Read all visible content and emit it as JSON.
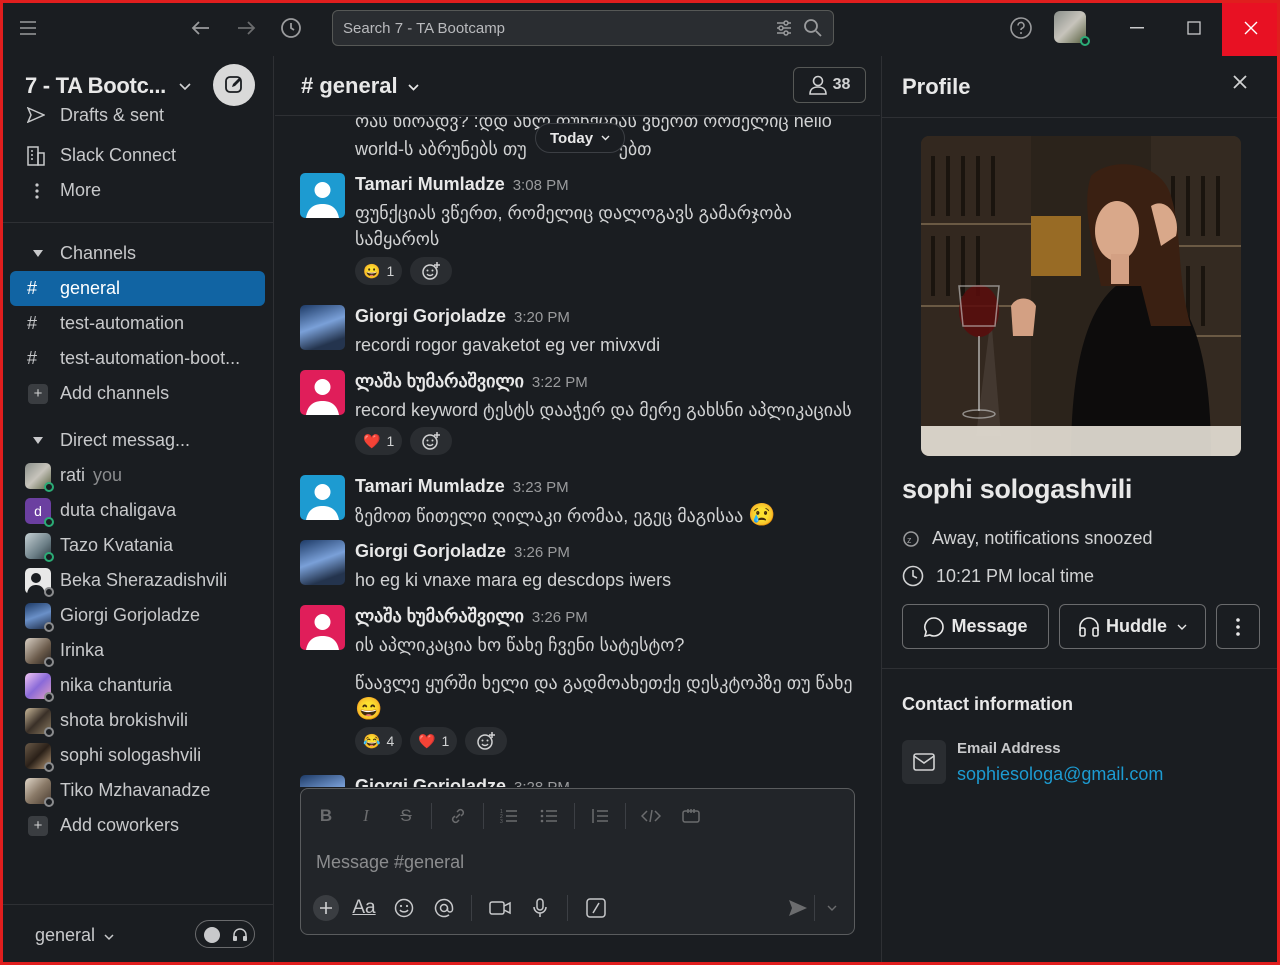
{
  "titlebar": {
    "search_placeholder": "Search 7 - TA Bootcamp"
  },
  "sidebar": {
    "workspace": "7 - TA Bootc...",
    "nav": [
      {
        "label": "Drafts & sent",
        "icon": "send-icon"
      },
      {
        "label": "Slack Connect",
        "icon": "building-icon"
      },
      {
        "label": "More",
        "icon": "more-vertical-icon"
      }
    ],
    "channels_header": "Channels",
    "channels": [
      {
        "label": "general",
        "active": true
      },
      {
        "label": "test-automation",
        "active": false
      },
      {
        "label": "test-automation-boot...",
        "active": false
      }
    ],
    "add_channels": "Add channels",
    "dm_header": "Direct messag...",
    "dms": [
      {
        "label": "rati",
        "suffix": "you",
        "color": "#8a8f7a"
      },
      {
        "label": "duta chaligava",
        "color": "#6b3fa0",
        "initial": "d"
      },
      {
        "label": "Tazo Kvatania",
        "color": "#8ea0a8"
      },
      {
        "label": "Beka Sherazadishvili",
        "color": "#e8e8e8"
      },
      {
        "label": "Giorgi Gorjoladze",
        "color": "#3d5c8a"
      },
      {
        "label": "Irinka",
        "color": "#9a8a7a"
      },
      {
        "label": "nika chanturia",
        "color": "#b07acc"
      },
      {
        "label": "shota brokishvili",
        "color": "#5a4a3a"
      },
      {
        "label": "sophi sologashvili",
        "color": "#4a3a2a"
      },
      {
        "label": "Tiko Mzhavanadze",
        "color": "#a89a88"
      }
    ],
    "add_coworkers": "Add coworkers",
    "footer_label": "general"
  },
  "channel": {
    "title": "# general",
    "member_count": "38",
    "today_label": "Today",
    "partial_line_1": "ოას ხიოადვ? :დდ ახლ ფუნქციას ვწეოთ ოოძელიც hello",
    "partial_line_2": "world-ს აბრუნებს თუ",
    "partial_line_2b": "ებთ",
    "messages": [
      {
        "name": "Tamari Mumladze",
        "time": "3:08 PM",
        "text": "ფუნქციას ვწერთ, რომელიც დალოგავს გამარჯობა სამყაროს"
      },
      {
        "name": "Giorgi Gorjoladze",
        "time": "3:20 PM",
        "text": "recordi rogor gavaketot eg ver mivxvdi"
      },
      {
        "name": "ლაშა ხუმარაშვილი",
        "time": "3:22 PM",
        "text": "record keyword ტესტს დააჭერ და მერე გახსნი აპლიკაციას"
      },
      {
        "name": "Tamari Mumladze",
        "time": "3:23 PM",
        "text": "ზემოთ წითელი ღილაკი რომაა, ეგეც მაგისაა"
      },
      {
        "name": "Giorgi Gorjoladze",
        "time": "3:26 PM",
        "text": "ho eg ki vnaxe mara eg descdops iwers"
      },
      {
        "name": "ლაშა ხუმარაშვილი",
        "time": "3:26 PM",
        "text": "ის აპლიკაცია ხო წახე ჩვენი სატესტო?",
        "text2": "წაავლე ყურში ხელი და გადმოახეთქე დესკტოპზე თუ წახე"
      },
      {
        "name": "Giorgi Gorjoladze",
        "time": "3:28 PM"
      }
    ],
    "reactions": {
      "m1": [
        {
          "emoji": "😀",
          "count": "1"
        }
      ],
      "m3": [
        {
          "emoji": "❤️",
          "count": "1"
        }
      ],
      "m6": [
        {
          "emoji": "😂",
          "count": "4"
        },
        {
          "emoji": "❤️",
          "count": "1"
        }
      ]
    },
    "emoji_m4": "😢",
    "emoji_m6": "😄",
    "composer_placeholder": "Message #general"
  },
  "profile": {
    "title": "Profile",
    "name": "sophi sologashvili",
    "status": "Away, notifications snoozed",
    "local_time": "10:21 PM local time",
    "message_btn": "Message",
    "huddle_btn": "Huddle",
    "contact_title": "Contact information",
    "email_label": "Email Address",
    "email_value": "sophiesologa@gmail.com"
  },
  "colors": {
    "accent": "#1164a3",
    "link": "#1d9bd1",
    "online": "#2bac76",
    "close_red": "#e81123"
  }
}
